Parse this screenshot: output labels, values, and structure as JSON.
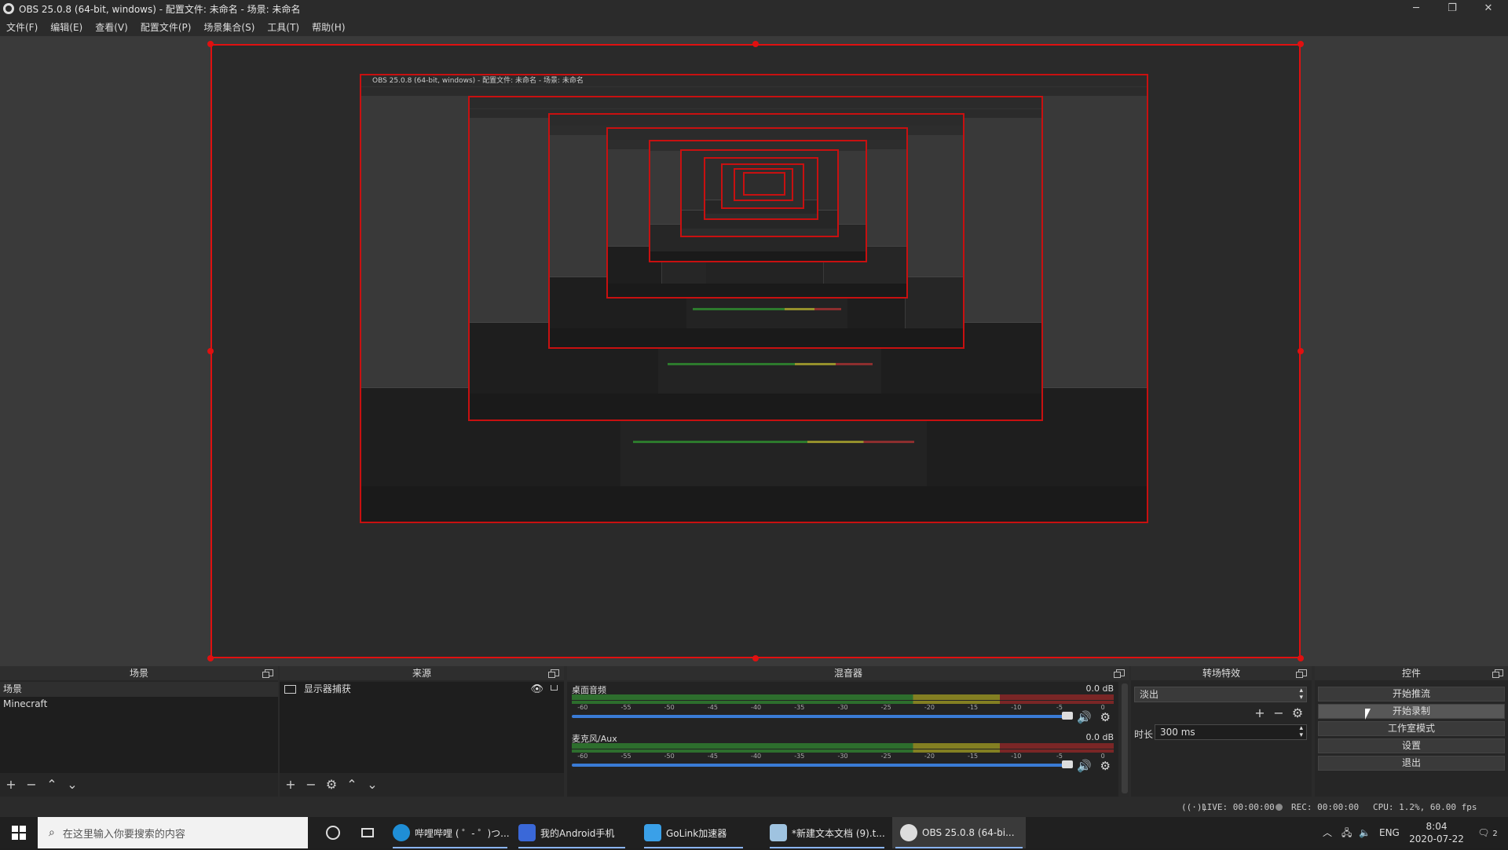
{
  "window": {
    "title": "OBS 25.0.8 (64-bit, windows) - 配置文件: 未命名 - 场景: 未命名",
    "minimize": "─",
    "maximize": "❐",
    "close": "✕"
  },
  "menu": [
    "文件(F)",
    "编辑(E)",
    "查看(V)",
    "配置文件(P)",
    "场景集合(S)",
    "工具(T)",
    "帮助(H)"
  ],
  "colors": {
    "selection_border": "#e01010",
    "accent_slider": "#3a7bd5",
    "meter_green": "#2d6e2d",
    "meter_yellow": "#837f22",
    "meter_red": "#7a2626"
  },
  "docks": {
    "scenes": {
      "header": "场景",
      "items": [
        "场景",
        "Minecraft"
      ],
      "toolbar": [
        "+",
        "−",
        "⌃",
        "⌄"
      ]
    },
    "sources": {
      "header": "来源",
      "items": [
        {
          "label": "显示器捕获",
          "icon": "monitor-icon"
        }
      ],
      "toolbar": [
        "+",
        "−",
        "⚙",
        "⌃",
        "⌄"
      ]
    },
    "mixer": {
      "header": "混音器",
      "channels": [
        {
          "name": "桌面音频",
          "db": "0.0 dB",
          "level": 0.79,
          "volume": 1.0
        },
        {
          "name": "麦克风/Aux",
          "db": "0.0 dB",
          "level": 0.0,
          "volume": 1.0
        }
      ],
      "scale": [
        "-60",
        "-55",
        "-50",
        "-45",
        "-40",
        "-35",
        "-30",
        "-25",
        "-20",
        "-15",
        "-10",
        "-5",
        "0"
      ]
    },
    "transitions": {
      "header": "转场特效",
      "selected": "淡出",
      "duration_label": "时长",
      "duration_value": "300 ms"
    },
    "controls": {
      "header": "控件",
      "buttons": [
        "开始推流",
        "开始录制",
        "工作室模式",
        "设置",
        "退出"
      ]
    }
  },
  "status": {
    "live": "LIVE: 00:00:00",
    "rec": "REC: 00:00:00",
    "cpu": "CPU: 1.2%, 60.00 fps"
  },
  "taskbar": {
    "search_placeholder": "在这里输入你要搜索的内容",
    "apps": [
      {
        "label": "哔哩哔哩 ( ゜- ゜)つ...",
        "icon": "edge-icon",
        "color": "#1f8ed6"
      },
      {
        "label": "我的Android手机",
        "icon": "phone-icon",
        "color": "#3a68d8"
      },
      {
        "label": "GoLink加速器",
        "icon": "golink-icon",
        "color": "#3aa0e8"
      },
      {
        "label": "*新建文本文档 (9).t...",
        "icon": "notepad-icon",
        "color": "#9fc3e0"
      },
      {
        "label": "OBS 25.0.8 (64-bi...",
        "icon": "obs-icon",
        "color": "#dddddd"
      }
    ],
    "language": "ENG",
    "time": "8:04",
    "date": "2020-07-22",
    "notifications": "2"
  },
  "nested": {
    "title": "OBS 25.0.8 (64-bit, windows) - 配置文件: 未命名 - 场景: 未命名"
  }
}
